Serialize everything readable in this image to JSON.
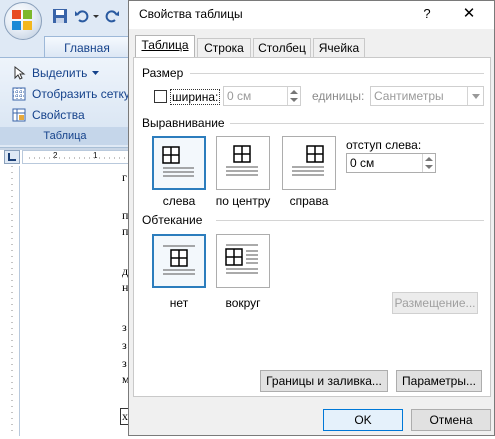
{
  "word": {
    "ribbon_tab": "Главная",
    "items": [
      {
        "label": "Выделить",
        "icon": "cursor-icon"
      },
      {
        "label": "Отобразить сетку",
        "icon": "grid-icon"
      },
      {
        "label": "Свойства",
        "icon": "properties-icon"
      }
    ],
    "group_label": "Таблица",
    "ruler_marks": [
      "2",
      "1"
    ],
    "doc_fragments": [
      "г",
      "п",
      "п",
      "д",
      "н",
      "з",
      "з",
      "з",
      "м",
      "х"
    ]
  },
  "dialog": {
    "title": "Свойства таблицы",
    "help_glyph": "?",
    "close_glyph": "✕",
    "tabs": [
      "Таблица",
      "Строка",
      "Столбец",
      "Ячейка"
    ],
    "size": {
      "section": "Размер",
      "width_label": "ширина:",
      "width_value": "0 см",
      "units_label": "единицы:",
      "units_value": "Сантиметры"
    },
    "alignment": {
      "section": "Выравнивание",
      "options": [
        "слева",
        "по центру",
        "справа"
      ],
      "selected": "слева",
      "indent_label": "отступ слева:",
      "indent_value": "0 см"
    },
    "wrapping": {
      "section": "Обтекание",
      "options": [
        "нет",
        "вокруг"
      ],
      "selected": "нет",
      "placement_button": "Размещение..."
    },
    "borders_button": "Границы и заливка...",
    "options_button": "Параметры...",
    "ok_button": "OK",
    "cancel_button": "Отмена"
  },
  "colors": {
    "accent": "#2c7dbd",
    "ribbon_text": "#15428b"
  }
}
